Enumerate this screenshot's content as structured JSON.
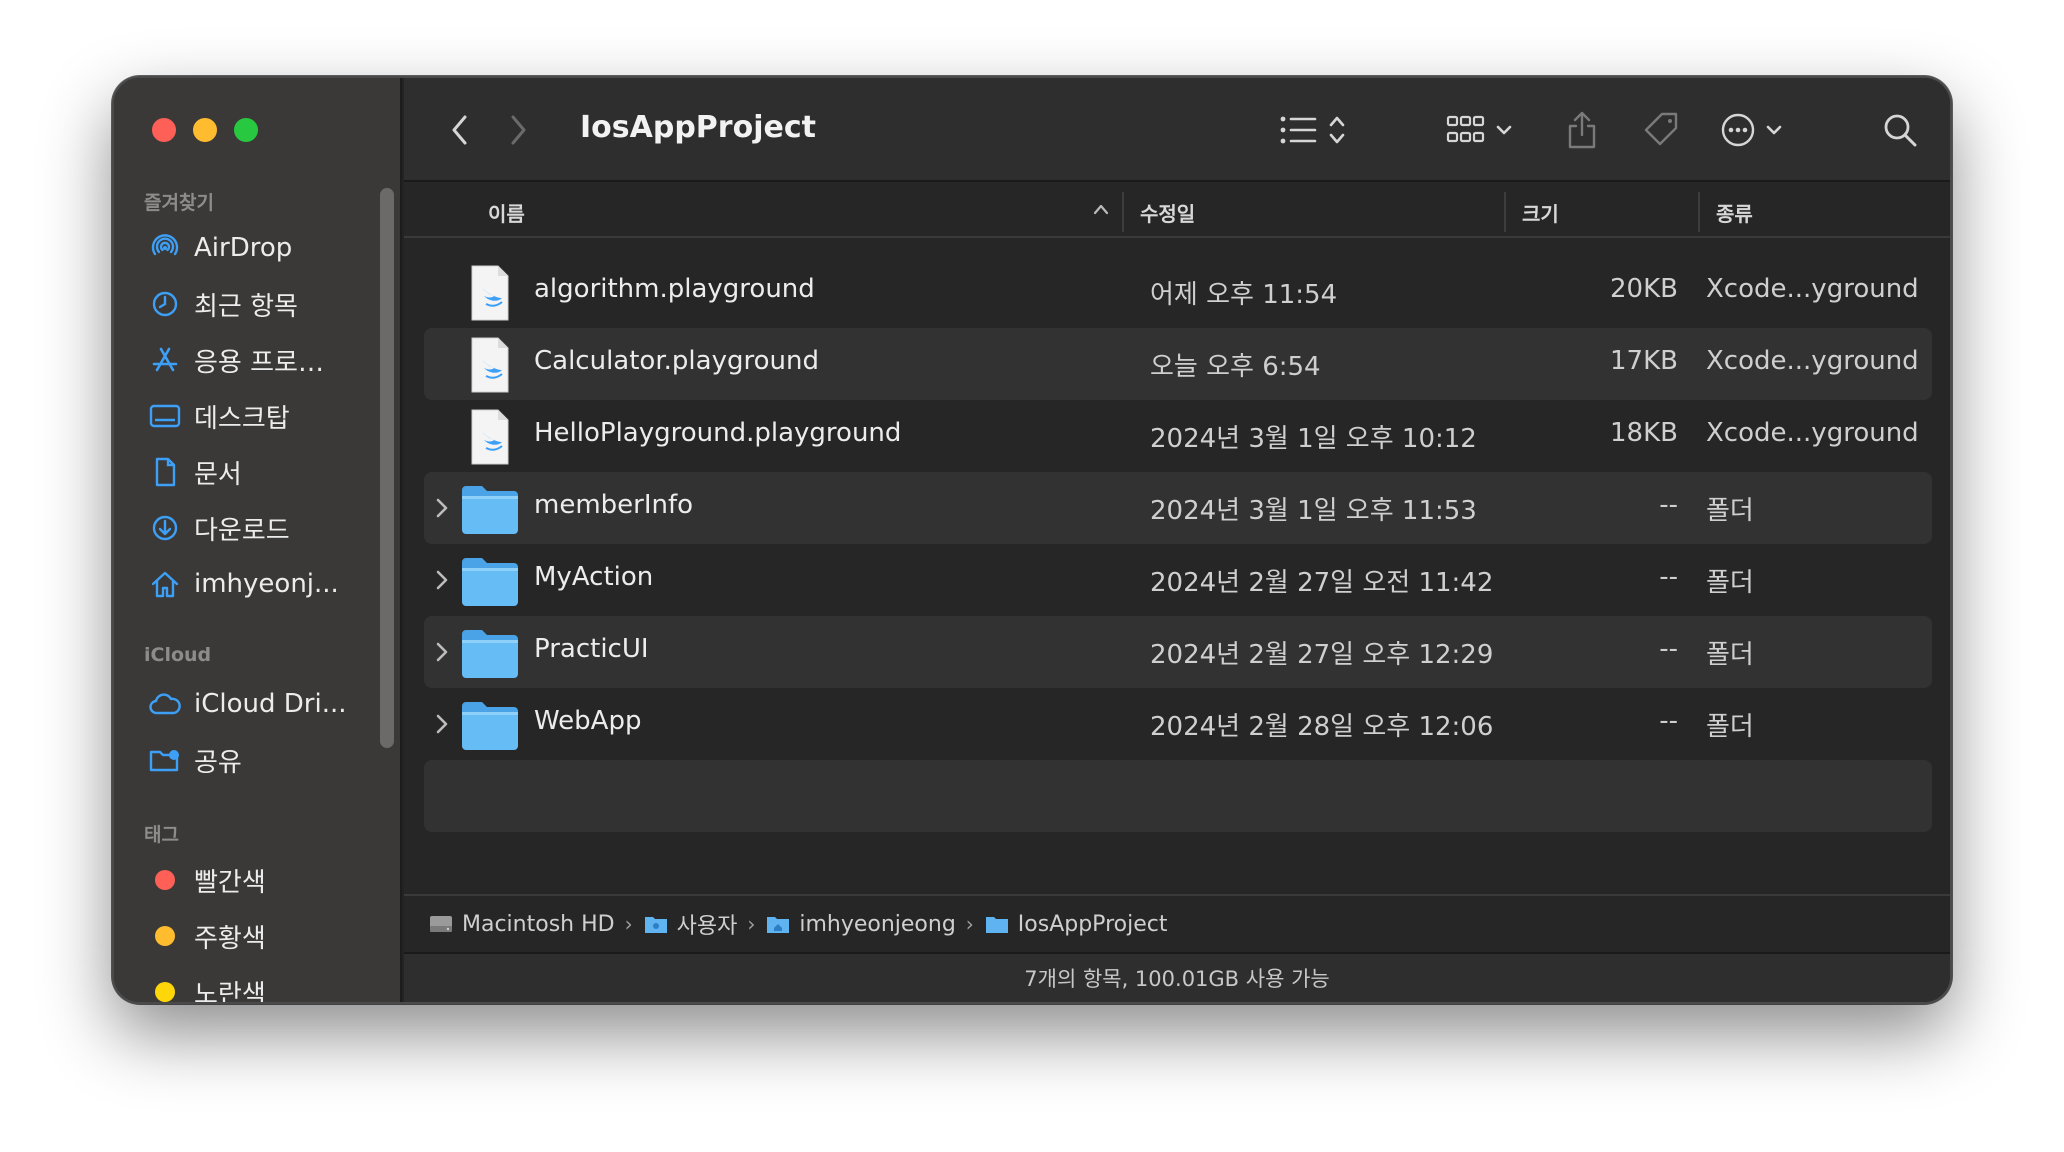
{
  "window": {
    "title": "IosAppProject"
  },
  "sidebar": {
    "favorites_header": "즐겨찾기",
    "favorites": [
      {
        "label": "AirDrop",
        "icon": "airdrop-icon"
      },
      {
        "label": "최근 항목",
        "icon": "clock-icon"
      },
      {
        "label": "응용 프로…",
        "icon": "applications-icon"
      },
      {
        "label": "데스크탑",
        "icon": "desktop-icon"
      },
      {
        "label": "문서",
        "icon": "document-icon"
      },
      {
        "label": "다운로드",
        "icon": "download-icon"
      },
      {
        "label": "imhyeonj...",
        "icon": "home-icon"
      }
    ],
    "icloud_header": "iCloud",
    "icloud": [
      {
        "label": "iCloud Dri...",
        "icon": "cloud-icon"
      },
      {
        "label": "공유",
        "icon": "shared-folder-icon"
      }
    ],
    "tags_header": "태그",
    "tags": [
      {
        "label": "빨간색",
        "color": "#fe5f57"
      },
      {
        "label": "주황색",
        "color": "#febc2e"
      },
      {
        "label": "노란색",
        "color": "#ffd60a"
      }
    ]
  },
  "columns": {
    "name": "이름",
    "modified": "수정일",
    "size": "크기",
    "kind": "종류"
  },
  "files": [
    {
      "name": "algorithm.playground",
      "date": "어제 오후 11:54",
      "size": "20KB",
      "kind": "Xcode...yground",
      "type": "playground"
    },
    {
      "name": "Calculator.playground",
      "date": "오늘 오후 6:54",
      "size": "17KB",
      "kind": "Xcode...yground",
      "type": "playground"
    },
    {
      "name": "HelloPlayground.playground",
      "date": "2024년 3월 1일 오후 10:12",
      "size": "18KB",
      "kind": "Xcode...yground",
      "type": "playground"
    },
    {
      "name": "memberInfo",
      "date": "2024년 3월 1일 오후 11:53",
      "size": "--",
      "kind": "폴더",
      "type": "folder"
    },
    {
      "name": "MyAction",
      "date": "2024년 2월 27일 오전 11:42",
      "size": "--",
      "kind": "폴더",
      "type": "folder"
    },
    {
      "name": "PracticUI",
      "date": "2024년 2월 27일 오후 12:29",
      "size": "--",
      "kind": "폴더",
      "type": "folder"
    },
    {
      "name": "WebApp",
      "date": "2024년 2월 28일 오후 12:06",
      "size": "--",
      "kind": "폴더",
      "type": "folder"
    }
  ],
  "path": [
    "Macintosh HD",
    "사용자",
    "imhyeonjeong",
    "IosAppProject"
  ],
  "status": "7개의 항목, 100.01GB 사용 가능",
  "colors": {
    "accent": "#3d9ff5",
    "folder": "#5fb3f0"
  }
}
